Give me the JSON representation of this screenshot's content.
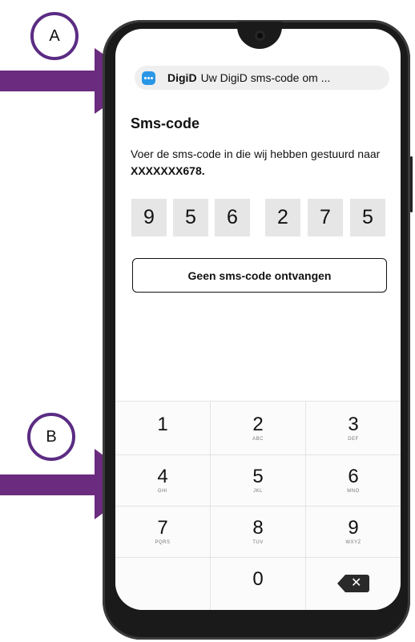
{
  "annotations": {
    "label_a": "A",
    "label_b": "B",
    "arrow_color": "#6b2b7e"
  },
  "notification": {
    "icon": "chat-bubble-icon",
    "icon_color": "#2a96e6",
    "app_name": "DigiD",
    "message": "Uw DigiD sms-code om ..."
  },
  "screen": {
    "title": "Sms-code",
    "description": "Voer de sms-code in die wij hebben gestuurd naar",
    "phone_number": "XXXXXXX678.",
    "code_digits": [
      "9",
      "5",
      "6",
      "2",
      "7",
      "5"
    ],
    "resend_button": "Geen sms-code ontvangen"
  },
  "keypad": {
    "keys": [
      {
        "digit": "1",
        "letters": ""
      },
      {
        "digit": "2",
        "letters": "ABC"
      },
      {
        "digit": "3",
        "letters": "DEF"
      },
      {
        "digit": "4",
        "letters": "GHI"
      },
      {
        "digit": "5",
        "letters": "JKL"
      },
      {
        "digit": "6",
        "letters": "MNO"
      },
      {
        "digit": "7",
        "letters": "PQRS"
      },
      {
        "digit": "8",
        "letters": "TUV"
      },
      {
        "digit": "9",
        "letters": "WXYZ"
      },
      {
        "digit": "0",
        "letters": ""
      }
    ],
    "backspace_icon": "backspace-icon"
  }
}
